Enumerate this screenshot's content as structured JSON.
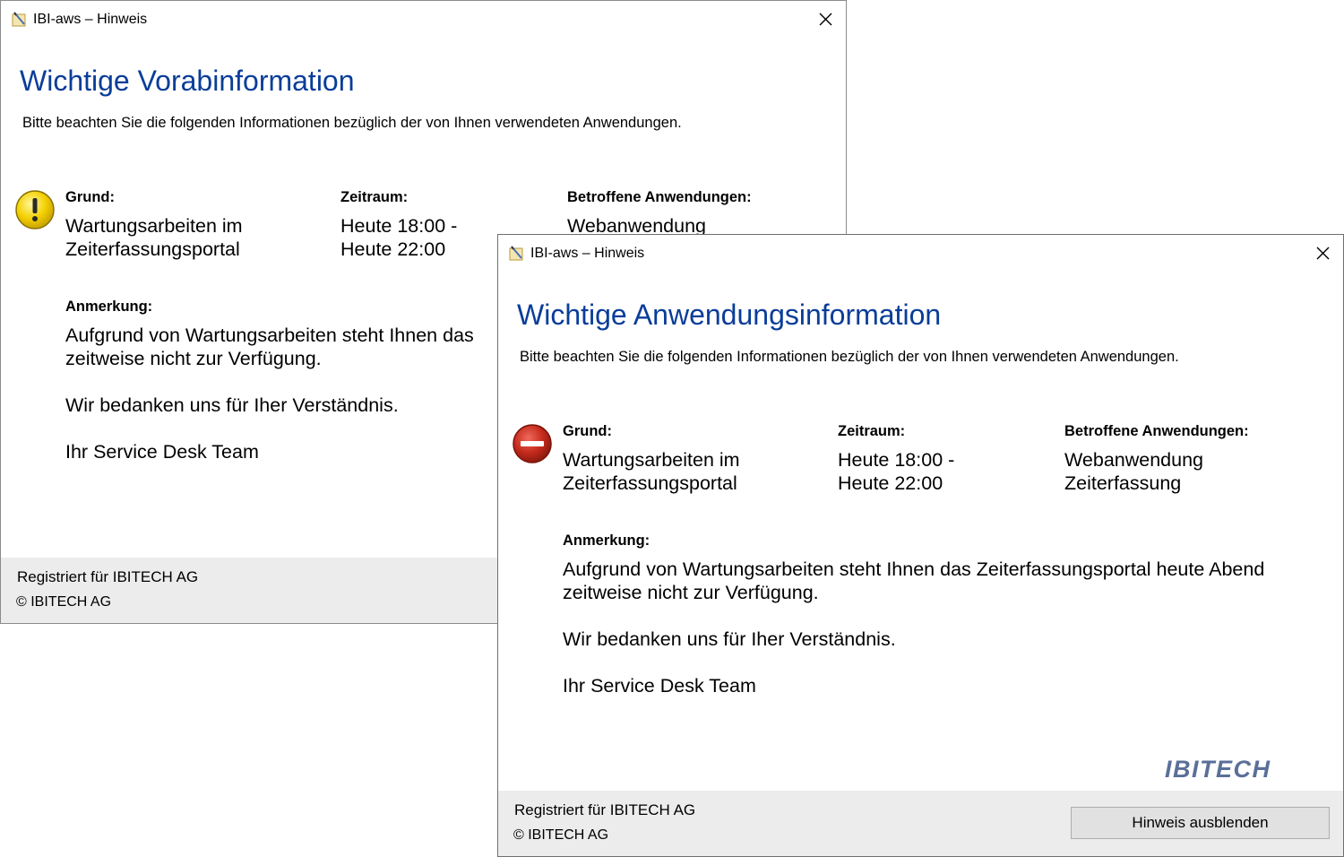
{
  "colors": {
    "heading": "#0a3d99",
    "footer_bg": "#ececec",
    "warning_icon": "#f4d000",
    "stop_icon": "#c42b1c",
    "logo": "#5a6f99"
  },
  "dialog_back": {
    "window_title": "IBI-aws – Hinweis",
    "heading": "Wichtige Vorabinformation",
    "subtitle": "Bitte beachten Sie die folgenden Informationen bezüglich der von Ihnen verwendeten Anwendungen.",
    "icon": "warning-icon",
    "grund_label": "Grund:",
    "grund_line1": "Wartungsarbeiten im",
    "grund_line2": "Zeiterfassungsportal",
    "zeitraum_label": "Zeitraum:",
    "zeitraum_line1": "Heute 18:00 -",
    "zeitraum_line2": "Heute 22:00",
    "apps_label": "Betroffene Anwendungen:",
    "apps_line1": "Webanwendung",
    "note_label": "Anmerkung:",
    "note_line1": "Aufgrund von Wartungsarbeiten steht Ihnen das",
    "note_line2": "zeitweise nicht zur Verfügung.",
    "note_thanks": "Wir bedanken uns für Iher Verständnis.",
    "note_team": "Ihr Service Desk Team",
    "footer_registered": "Registriert für IBITECH AG",
    "footer_copyright": "© IBITECH AG"
  },
  "dialog_front": {
    "window_title": "IBI-aws – Hinweis",
    "heading": "Wichtige Anwendungsinformation",
    "subtitle": "Bitte beachten Sie die folgenden Informationen bezüglich der von Ihnen verwendeten Anwendungen.",
    "icon": "stop-icon",
    "grund_label": "Grund:",
    "grund_line1": "Wartungsarbeiten im",
    "grund_line2": "Zeiterfassungsportal",
    "zeitraum_label": "Zeitraum:",
    "zeitraum_line1": "Heute 18:00 -",
    "zeitraum_line2": "Heute 22:00",
    "apps_label": "Betroffene Anwendungen:",
    "apps_line1": "Webanwendung",
    "apps_line2": "Zeiterfassung",
    "note_label": "Anmerkung:",
    "note_line1": "Aufgrund von Wartungsarbeiten steht Ihnen das Zeiterfassungsportal heute Abend",
    "note_line2": "zeitweise nicht zur Verfügung.",
    "note_thanks": "Wir bedanken uns für Iher Verständnis.",
    "note_team": "Ihr Service Desk Team",
    "logo_text": "IBITECH",
    "footer_registered": "Registriert für IBITECH AG",
    "footer_copyright": "© IBITECH AG",
    "hide_button": "Hinweis ausblenden"
  }
}
